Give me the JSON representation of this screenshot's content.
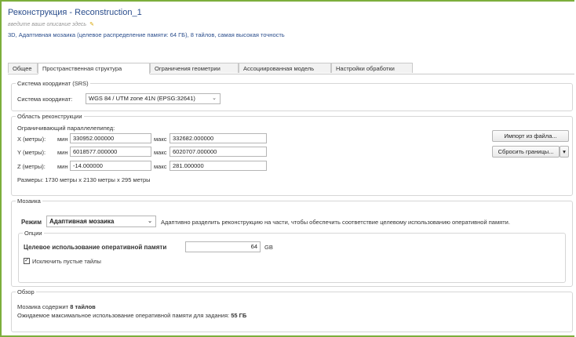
{
  "window": {
    "title": "Реконструкция - Reconstruction_1",
    "description_placeholder": "введите ваше описание здесь",
    "summary": "3D, Адаптивная мозаика (целевое распределение памяти: 64 ГБ), 8 тайлов, самая высокая точность"
  },
  "tabs": [
    {
      "label": "Общее"
    },
    {
      "label": "Пространственная структура"
    },
    {
      "label": "Ограничения геометрии"
    },
    {
      "label": "Ассоциированная модель"
    },
    {
      "label": "Настройки обработки"
    }
  ],
  "active_tab": 1,
  "srs": {
    "group_label": "Система координат (SRS)",
    "label": "Система координат:",
    "value": "WGS 84 / UTM zone 41N (EPSG:32641)"
  },
  "area": {
    "group_label": "Область реконструкции",
    "bbox_label": "Ограничивающий параллелепипед:",
    "rows": [
      {
        "axis": "X (метры):",
        "min_label": "мин",
        "min": "330952.000000",
        "max_label": "макс",
        "max": "332682.000000"
      },
      {
        "axis": "Y (метры):",
        "min_label": "мин",
        "min": "6018577.000000",
        "max_label": "макс",
        "max": "6020707.000000"
      },
      {
        "axis": "Z (метры):",
        "min_label": "мин",
        "min": "-14.000000",
        "max_label": "макс",
        "max": "281.000000"
      }
    ],
    "dimensions": "Размеры: 1730 метры x 2130 метры x 295 метры",
    "import_button": "Импорт из файла...",
    "reset_button": "Сбросить границы..."
  },
  "tiling": {
    "group_label": "Мозаика",
    "mode_label": "Режим",
    "mode_value": "Адаптивная мозаика",
    "mode_description": "Адаптивно разделить реконструкцию на части, чтобы обеспечить соответствие целевому использованию оперативной памяти.",
    "options_label": "Опции",
    "memory_label": "Целевое использование оперативной памяти",
    "memory_value": "64",
    "memory_unit": "GB",
    "discard_empty_label": "Исключить пустые тайлы",
    "discard_empty_checked": true
  },
  "overview": {
    "group_label": "Обзор",
    "tiles_prefix": "Мозаика содержит",
    "tiles_count": "8 тайлов",
    "memory_prefix": "Ожидаемое максимальное использование оперативной памяти для задания:",
    "memory_value": "55 ГБ"
  },
  "colors": {
    "frame": "#7cae3c",
    "title": "#2a4d8c"
  }
}
